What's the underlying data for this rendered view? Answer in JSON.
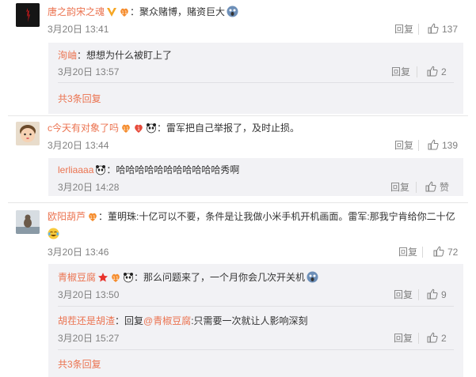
{
  "comments": [
    {
      "user": "唐之韵宋之魂",
      "text": "：聚众赌博，赌资巨大",
      "time": "3月20日 13:41",
      "reply_label": "回复",
      "likes": "137",
      "replies": [
        {
          "user": "洵岫",
          "text": "：想想为什么被盯上了",
          "time": "3月20日 13:57",
          "reply_label": "回复",
          "likes": "2"
        }
      ],
      "more": "共3条回复"
    },
    {
      "user": "c今天有对象了吗",
      "text": "：雷军把自己举报了，及时止损。",
      "time": "3月20日 13:44",
      "reply_label": "回复",
      "likes": "139",
      "replies": [
        {
          "user": "lerliaaaa",
          "text": "：哈哈哈哈哈哈哈哈哈哈哈秀啊",
          "time": "3月20日 14:28",
          "reply_label": "回复",
          "likes": "赞"
        }
      ]
    },
    {
      "user": "欧阳葫芦",
      "text": "：董明珠:十亿可以不要，条件是让我做小米手机开机画面。雷军:那我宁肯给你二十亿",
      "time": "3月20日 13:46",
      "reply_label": "回复",
      "likes": "72",
      "replies": [
        {
          "user": "青椒豆腐",
          "text": "：那么问题来了，一个月你会几次开关机",
          "time": "3月20日 13:50",
          "reply_label": "回复",
          "likes": "9"
        },
        {
          "user": "胡茬还是胡渣",
          "text_prefix": "：回复",
          "mention": "@青椒豆腐",
          "text": ":只需要一次就让人影响深刻",
          "time": "3月20日 15:27",
          "reply_label": "回复",
          "likes": "2"
        }
      ],
      "more": "共3条回复"
    }
  ],
  "colors": {
    "link": "#eb7350",
    "reply_bg": "#f2f2f5",
    "meta": "#808080",
    "verified": "#f6a623"
  }
}
